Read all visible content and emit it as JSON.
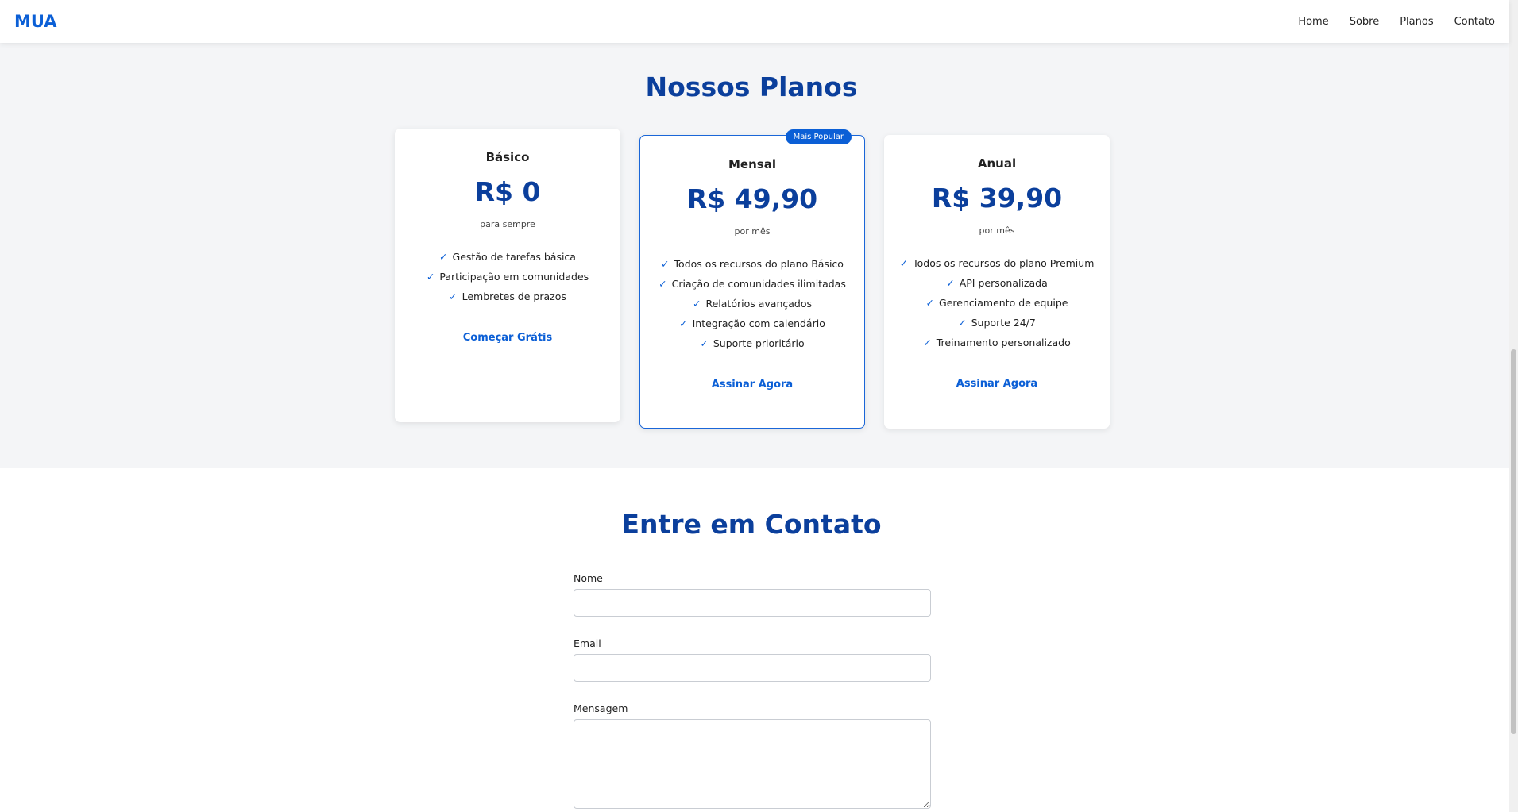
{
  "nav": {
    "logo": "MUA",
    "links": [
      "Home",
      "Sobre",
      "Planos",
      "Contato"
    ]
  },
  "plans": {
    "title": "Nossos Planos",
    "cards": [
      {
        "name": "Básico",
        "price": "R$ 0",
        "period": "para sempre",
        "features": [
          "Gestão de tarefas básica",
          "Participação em comunidades",
          "Lembretes de prazos"
        ],
        "action": "Começar Grátis"
      },
      {
        "badge": "Mais Popular",
        "name": "Mensal",
        "price": "R$ 49,90",
        "period": "por mês",
        "features": [
          "Todos os recursos do plano Básico",
          "Criação de comunidades ilimitadas",
          "Relatórios avançados",
          "Integração com calendário",
          "Suporte prioritário"
        ],
        "action": "Assinar Agora"
      },
      {
        "name": "Anual",
        "price": "R$ 39,90",
        "period": "por mês",
        "features": [
          "Todos os recursos do plano Premium",
          "API personalizada",
          "Gerenciamento de equipe",
          "Suporte 24/7",
          "Treinamento personalizado"
        ],
        "action": "Assinar Agora"
      }
    ],
    "check_glyph": "✓"
  },
  "contact": {
    "title": "Entre em Contato",
    "fields": {
      "name_label": "Nome",
      "email_label": "Email",
      "message_label": "Mensagem"
    }
  },
  "colors": {
    "accent": "#0b5fd6",
    "heading": "#0b3f9c",
    "section_bg": "#f4f5f7"
  }
}
